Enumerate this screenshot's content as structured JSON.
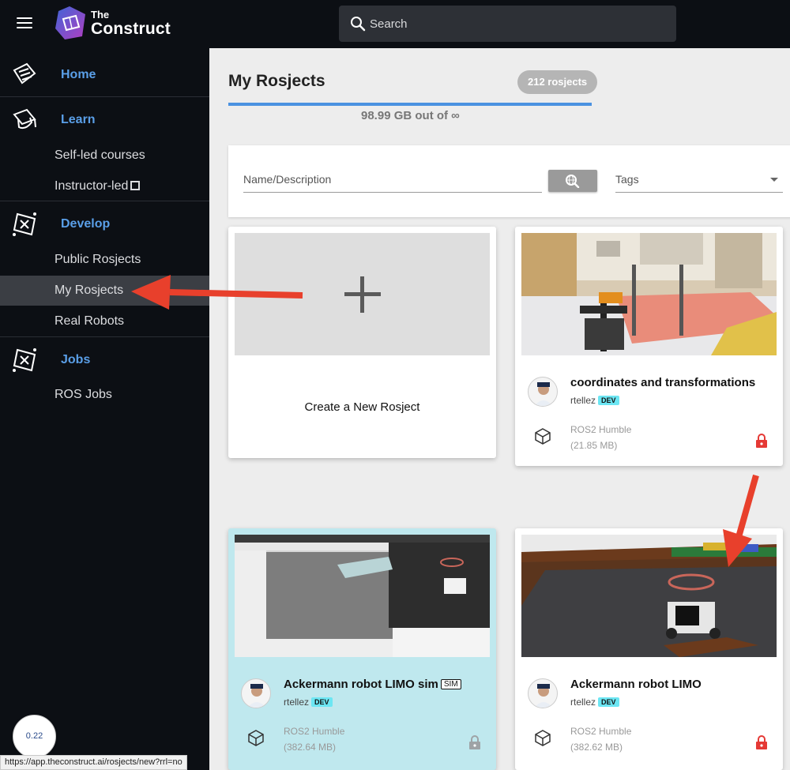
{
  "topbar": {
    "logo_small": "The",
    "logo_big": "Construct",
    "search_placeholder": "Search"
  },
  "sidebar": {
    "home": "Home",
    "learn": "Learn",
    "self_led": "Self-led courses",
    "instructor_led": "Instructor-led",
    "develop": "Develop",
    "public_rosjects": "Public Rosjects",
    "my_rosjects": "My Rosjects",
    "real_robots": "Real Robots",
    "jobs": "Jobs",
    "ros_jobs": "ROS Jobs"
  },
  "main": {
    "title": "My Rosjects",
    "count": "212 rosjects",
    "storage": "98.99 GB out of ∞",
    "filter_placeholder": "Name/Description",
    "tags_placeholder": "Tags",
    "create_label": "Create a New Rosject",
    "cards": [
      {
        "title": "coordinates and transformations",
        "author": "rtellez",
        "badge": "DEV",
        "distro": "ROS2 Humble",
        "size": "(21.85 MB)",
        "locked": true
      },
      {
        "title": "Ackermann robot LIMO sim",
        "tag": "SIM",
        "author": "rtellez",
        "badge": "DEV",
        "distro": "ROS2 Humble",
        "size": "(382.64 MB)",
        "locked": false
      },
      {
        "title": "Ackermann robot LIMO",
        "author": "rtellez",
        "badge": "DEV",
        "distro": "ROS2 Humble",
        "size": "(382.62 MB)",
        "locked": true
      }
    ]
  },
  "status_bar": {
    "url": "https://app.theconstruct.ai/rosjects/new?rrl=no",
    "zoom": "0.22"
  },
  "colors": {
    "accent_blue": "#4b92e1",
    "nav_blue": "#5a9fe8",
    "lock_red": "#e53935",
    "arrow_red": "#e8402c",
    "highlight_card": "#bfe8ee"
  }
}
